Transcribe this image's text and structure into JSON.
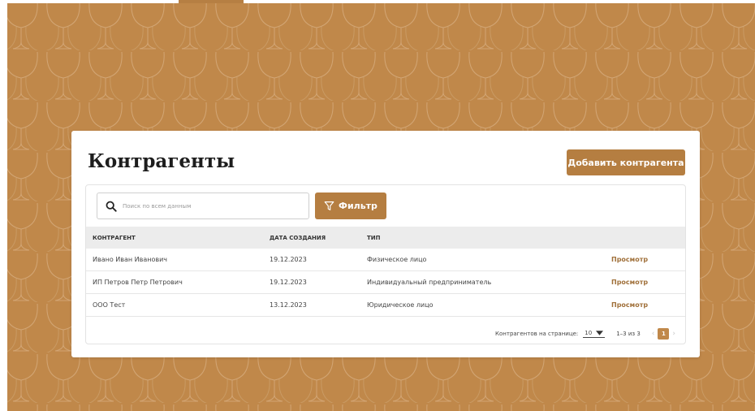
{
  "page": {
    "title": "Контрагенты",
    "add_button_label": "Добавить контрагента"
  },
  "toolbar": {
    "search_placeholder": "Поиск по всем данным",
    "filter_label": "Фильтр"
  },
  "table": {
    "columns": [
      "КОНТРАГЕНТ",
      "ДАТА СОЗДАНИЯ",
      "ТИП"
    ],
    "rows": [
      {
        "name": "Ивано Иван Иванович",
        "date": "19.12.2023",
        "type": "Физическое лицо",
        "action": "Просмотр"
      },
      {
        "name": "ИП Петров Петр Петрович",
        "date": "19.12.2023",
        "type": "Индивидуальный предприниматель",
        "action": "Просмотр"
      },
      {
        "name": "ООО Тест",
        "date": "13.12.2023",
        "type": "Юридическое лицо",
        "action": "Просмотр"
      }
    ]
  },
  "pagination": {
    "per_page_label": "Контрагентов на странице:",
    "per_page_value": "10",
    "range": "1–3 из 3",
    "current_page": "1"
  },
  "colors": {
    "accent": "#b57e41",
    "background": "#c0884a"
  }
}
